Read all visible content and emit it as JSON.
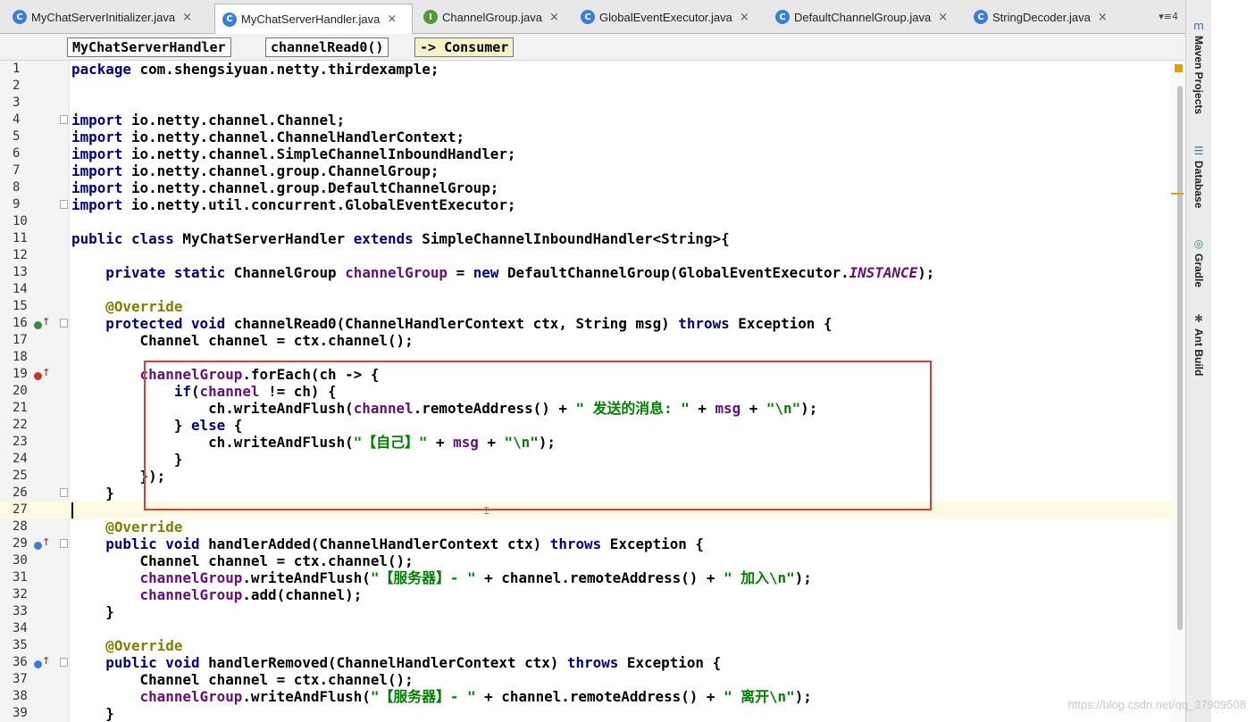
{
  "tabs": [
    {
      "label": "MyChatServerInitializer.java",
      "icon": "C",
      "active": false
    },
    {
      "label": "MyChatServerHandler.java",
      "icon": "C",
      "active": true
    },
    {
      "label": "ChannelGroup.java",
      "icon": "I",
      "active": false
    },
    {
      "label": "GlobalEventExecutor.java",
      "icon": "C",
      "active": false
    },
    {
      "label": "DefaultChannelGroup.java",
      "icon": "C",
      "active": false
    },
    {
      "label": "StringDecoder.java",
      "icon": "C",
      "active": false
    }
  ],
  "tab_close": "×",
  "tab_overflow": "▾≡4",
  "breadcrumb": [
    "MyChatServerHandler",
    "channelRead0()",
    "-> Consumer"
  ],
  "tool_windows": [
    {
      "label": "Maven Projects",
      "icon": "maven-icon"
    },
    {
      "label": "Database",
      "icon": "database-icon"
    },
    {
      "label": "Gradle",
      "icon": "gradle-icon"
    },
    {
      "label": "Ant Build",
      "icon": "ant-icon"
    }
  ],
  "line_numbers": [
    "1",
    "2",
    "3",
    "4",
    "5",
    "6",
    "7",
    "8",
    "9",
    "10",
    "11",
    "12",
    "13",
    "14",
    "15",
    "16",
    "17",
    "18",
    "19",
    "20",
    "21",
    "22",
    "23",
    "24",
    "25",
    "26",
    "27",
    "28",
    "29",
    "30",
    "31",
    "32",
    "33",
    "34",
    "35",
    "36",
    "37",
    "38",
    "39"
  ],
  "code": {
    "l1": {
      "kw": "package",
      "rest": " com.shengsiyuan.netty.thirdexample;"
    },
    "l4": {
      "kw": "import",
      "rest": " io.netty.channel.Channel;"
    },
    "l5": {
      "kw": "import",
      "rest": " io.netty.channel.ChannelHandlerContext;"
    },
    "l6": {
      "kw": "import",
      "rest": " io.netty.channel.SimpleChannelInboundHandler;"
    },
    "l7": {
      "kw": "import",
      "rest": " io.netty.channel.group.ChannelGroup;"
    },
    "l8": {
      "kw": "import",
      "rest": " io.netty.channel.group.DefaultChannelGroup;"
    },
    "l9": {
      "kw": "import",
      "rest": " io.netty.util.concurrent.GlobalEventExecutor;"
    },
    "l11": {
      "kw1": "public class",
      "mid": " MyChatServerHandler ",
      "kw2": "extends",
      "rest": " SimpleChannelInboundHandler<String>{"
    },
    "l13": {
      "indent": "    ",
      "kw1": "private static",
      "t1": " ChannelGroup ",
      "field": "channelGroup",
      "t2": " = ",
      "kw2": "new",
      "t3": " DefaultChannelGroup(GlobalEventExecutor.",
      "ital": "INSTANCE",
      "t4": ");"
    },
    "l15": {
      "indent": "    ",
      "ann": "@Override"
    },
    "l16": {
      "indent": "    ",
      "kw1": "protected void",
      "t1": " channelRead0(ChannelHandlerContext ctx, String msg) ",
      "kw2": "throws",
      "t2": " Exception {"
    },
    "l17": {
      "indent": "        ",
      "t1": "Channel channel = ctx.channel();"
    },
    "l19": {
      "indent": "        ",
      "field": "channelGroup",
      "t1": ".forEach(ch -> {"
    },
    "l20": {
      "indent": "            ",
      "kw1": "if",
      "t1": "(",
      "field": "channel",
      "t2": " != ch) {"
    },
    "l21": {
      "indent": "                ",
      "t1": "ch.writeAndFlush(",
      "field": "channel",
      "t2": ".remoteAddress() + ",
      "s1": "\" 发送的消息: \"",
      "t3": " + ",
      "field2": "msg",
      "t4": " + ",
      "s2": "\"\\n\"",
      "t5": ");"
    },
    "l22": {
      "indent": "            ",
      "t1": "} ",
      "kw1": "else",
      "t2": " {"
    },
    "l23": {
      "indent": "                ",
      "t1": "ch.writeAndFlush(",
      "s1": "\"【自己】\"",
      "t2": " + ",
      "field": "msg",
      "t3": " + ",
      "s2": "\"\\n\"",
      "t4": ");"
    },
    "l24": {
      "indent": "            ",
      "t1": "}"
    },
    "l25": {
      "indent": "        ",
      "t1": "});"
    },
    "l26": {
      "indent": "    ",
      "t1": "}"
    },
    "l28": {
      "indent": "    ",
      "ann": "@Override"
    },
    "l29": {
      "indent": "    ",
      "kw1": "public void",
      "t1": " handlerAdded(ChannelHandlerContext ctx) ",
      "kw2": "throws",
      "t2": " Exception {"
    },
    "l30": {
      "indent": "        ",
      "t1": "Channel channel = ctx.channel();"
    },
    "l31": {
      "indent": "        ",
      "field": "channelGroup",
      "t1": ".writeAndFlush(",
      "s1": "\"【服务器】- \"",
      "t2": " + channel.remoteAddress() + ",
      "s2": "\" 加入\\n\"",
      "t3": ");"
    },
    "l32": {
      "indent": "        ",
      "field": "channelGroup",
      "t1": ".add(channel);"
    },
    "l33": {
      "indent": "    ",
      "t1": "}"
    },
    "l35": {
      "indent": "    ",
      "ann": "@Override"
    },
    "l36": {
      "indent": "    ",
      "kw1": "public void",
      "t1": " handlerRemoved(ChannelHandlerContext ctx) ",
      "kw2": "throws",
      "t2": " Exception {"
    },
    "l37": {
      "indent": "        ",
      "t1": "Channel channel = ctx.channel();"
    },
    "l38": {
      "indent": "        ",
      "field": "channelGroup",
      "t1": ".writeAndFlush(",
      "s1": "\"【服务器】- \"",
      "t2": " + channel.remoteAddress() + ",
      "s2": "\" 离开\\n\"",
      "t3": ");"
    },
    "l39": {
      "indent": "    ",
      "t1": "}"
    }
  },
  "watermark": "https://blog.csdn.net/qq_37909508",
  "colors": {
    "keyword": "#000080",
    "field": "#660e7a",
    "string": "#008000",
    "annotation": "#808000",
    "highlight_box": "#e23b3b",
    "caret_line": "#fffbe3"
  }
}
